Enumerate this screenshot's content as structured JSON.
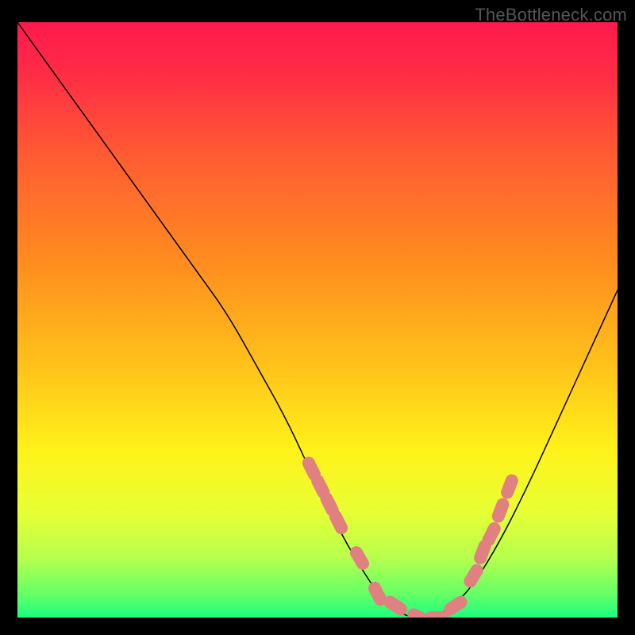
{
  "watermark": "TheBottleneck.com",
  "chart_data": {
    "type": "line",
    "title": "",
    "xlabel": "",
    "ylabel": "",
    "xlim": [
      0,
      100
    ],
    "ylim": [
      0,
      100
    ],
    "x": [
      0,
      5,
      10,
      15,
      20,
      25,
      30,
      35,
      40,
      45,
      50,
      55,
      60,
      62,
      65,
      70,
      75,
      80,
      85,
      90,
      95,
      100
    ],
    "values": [
      100,
      93,
      86,
      79,
      72,
      65,
      58,
      51,
      42,
      33,
      22,
      12,
      4,
      2,
      0,
      0,
      4,
      12,
      22,
      33,
      44,
      55
    ],
    "markers": {
      "x": [
        49,
        50.5,
        52,
        53.5,
        57,
        60,
        63,
        67,
        70,
        73,
        76,
        77.5,
        79,
        80.5,
        82
      ],
      "values": [
        25,
        22,
        19,
        16,
        10,
        4,
        2,
        0,
        0,
        2,
        7,
        11,
        14,
        18,
        22
      ]
    },
    "gradient_stops": [
      {
        "offset": 0.0,
        "color": "#ff1a4d"
      },
      {
        "offset": 0.08,
        "color": "#ff2a46"
      },
      {
        "offset": 0.22,
        "color": "#ff5a33"
      },
      {
        "offset": 0.4,
        "color": "#ff8c1f"
      },
      {
        "offset": 0.58,
        "color": "#ffc31a"
      },
      {
        "offset": 0.72,
        "color": "#fff21a"
      },
      {
        "offset": 0.82,
        "color": "#e8ff33"
      },
      {
        "offset": 0.9,
        "color": "#b6ff4d"
      },
      {
        "offset": 0.96,
        "color": "#66ff66"
      },
      {
        "offset": 1.0,
        "color": "#1aff80"
      }
    ]
  }
}
